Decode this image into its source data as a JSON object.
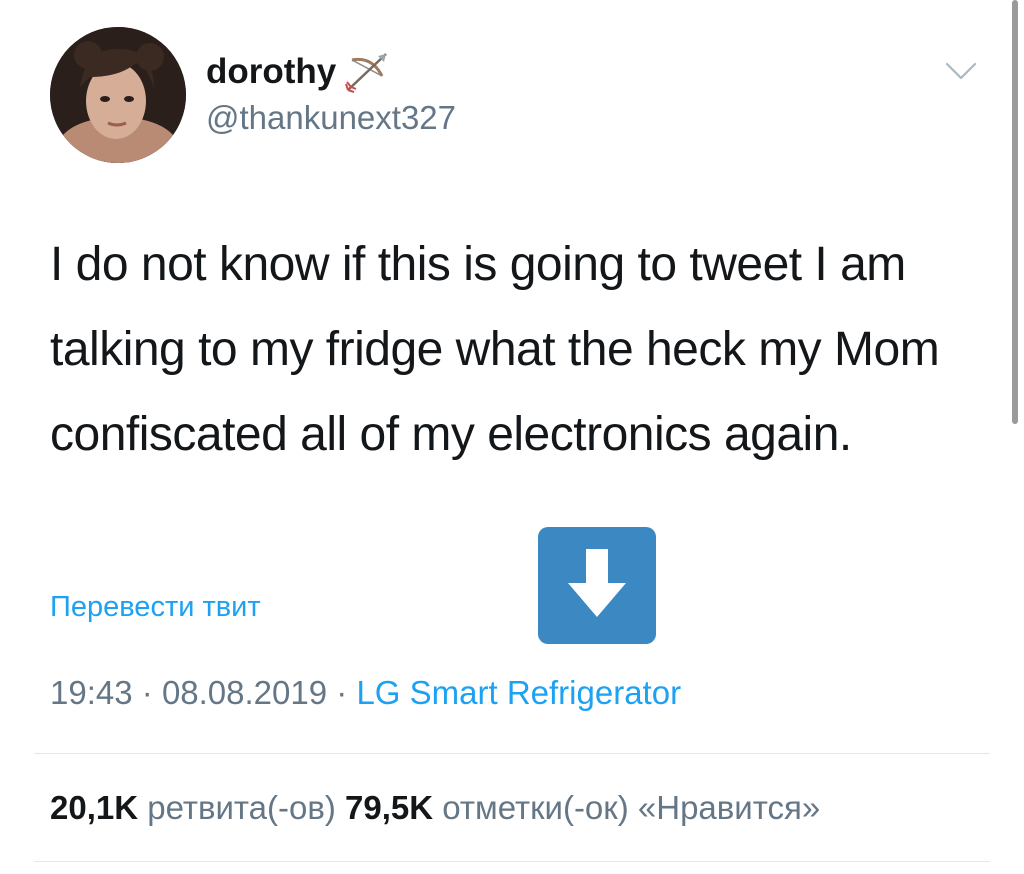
{
  "author": {
    "display_name": "dorothy",
    "name_emoji": "bow-and-arrow-icon",
    "handle": "@thankunext327"
  },
  "tweet": {
    "text": "I do not know if this is going to tweet I am talking to my fridge what the heck my Mom confiscated all of my electronics again."
  },
  "translate_label": "Перевести твит",
  "meta": {
    "time": "19:43",
    "separator": "·",
    "date": "08.08.2019",
    "source": "LG Smart Refrigerator"
  },
  "stats": {
    "retweets_count": "20,1K",
    "retweets_label": "ретвита(-ов)",
    "likes_count": "79,5K",
    "likes_label": "отметки(-ок) «Нравится»"
  },
  "colors": {
    "link": "#1da1f2",
    "secondary_text": "#657786",
    "primary_text": "#14171a",
    "download_badge": "#3b88c3"
  },
  "icons": {
    "chevron": "chevron-down-icon",
    "download": "down-arrow-icon"
  }
}
